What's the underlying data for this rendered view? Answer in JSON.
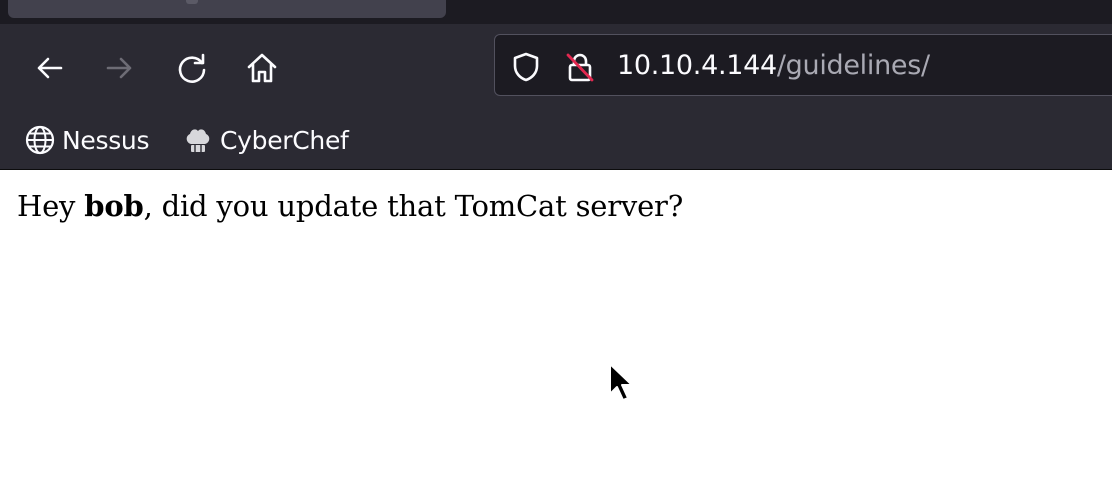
{
  "browser": {
    "nav": {
      "back_icon": "arrow-left-icon",
      "forward_icon": "arrow-right-icon",
      "reload_icon": "reload-icon",
      "home_icon": "home-icon"
    },
    "urlbar": {
      "host": "10.10.4.144",
      "path": "/guidelines/",
      "shield_icon": "shield-icon",
      "insecure_lock_icon": "insecure-lock-icon"
    },
    "bookmarks": [
      {
        "label": "Nessus",
        "icon": "globe-icon"
      },
      {
        "label": "CyberChef",
        "icon": "chef-hat-icon"
      }
    ],
    "colors": {
      "chrome": "#2b2a33",
      "tabstrip": "#1c1b22",
      "url_field": "#1c1b22",
      "text_primary": "#fbfbfe",
      "text_secondary": "#a9a9b3",
      "insecure_red": "#e22850"
    }
  },
  "page": {
    "message": {
      "prefix": "Hey ",
      "name": "bob",
      "suffix": ", did you update that TomCat server?"
    }
  }
}
